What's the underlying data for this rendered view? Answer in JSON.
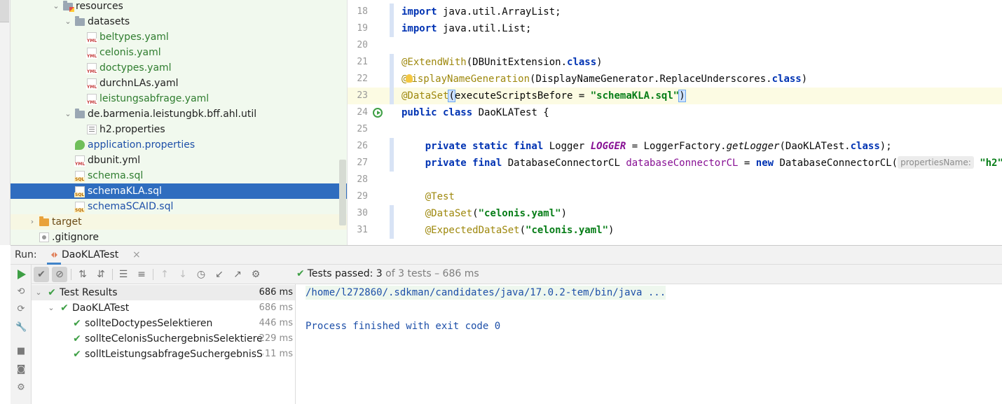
{
  "project_tree": {
    "items": [
      {
        "label": "resources",
        "icon": "resources-folder-icon",
        "color": "black",
        "depth": 3,
        "expanded": true
      },
      {
        "label": "datasets",
        "icon": "folder-icon",
        "color": "black",
        "depth": 4,
        "expanded": true
      },
      {
        "label": "beltypes.yaml",
        "icon": "yaml-file-icon",
        "color": "green",
        "depth": 5
      },
      {
        "label": "celonis.yaml",
        "icon": "yaml-file-icon",
        "color": "green",
        "depth": 5
      },
      {
        "label": "doctypes.yaml",
        "icon": "yaml-file-icon",
        "color": "green",
        "depth": 5
      },
      {
        "label": "durchnLAs.yaml",
        "icon": "yaml-file-icon",
        "color": "black",
        "depth": 5
      },
      {
        "label": "leistungsabfrage.yaml",
        "icon": "yaml-file-icon",
        "color": "green",
        "depth": 5
      },
      {
        "label": "de.barmenia.leistungbk.bff.ahl.util",
        "icon": "folder-icon",
        "color": "black",
        "depth": 4,
        "expanded": true
      },
      {
        "label": "h2.properties",
        "icon": "properties-file-icon",
        "color": "black",
        "depth": 5
      },
      {
        "label": "application.properties",
        "icon": "spring-properties-icon",
        "color": "blue",
        "depth": 4
      },
      {
        "label": "dbunit.yml",
        "icon": "yaml-file-icon",
        "color": "black",
        "depth": 4
      },
      {
        "label": "schema.sql",
        "icon": "sql-file-icon",
        "color": "green",
        "depth": 4
      },
      {
        "label": "schemaKLA.sql",
        "icon": "sql-file-icon",
        "color": "white",
        "depth": 4,
        "selected": true
      },
      {
        "label": "schemaSCAID.sql",
        "icon": "sql-file-icon",
        "color": "blue",
        "depth": 4
      },
      {
        "label": "target",
        "icon": "excluded-folder-icon",
        "color": "brown",
        "depth": 1,
        "expanded": false
      },
      {
        "label": ".gitignore",
        "icon": "gitignore-file-icon",
        "color": "black",
        "depth": 1
      }
    ]
  },
  "editor": {
    "lines": [
      {
        "n": "18",
        "tokens": [
          [
            "kw",
            "import"
          ],
          [
            "",
            "java.util.ArrayList;"
          ]
        ]
      },
      {
        "n": "19",
        "tokens": [
          [
            "kw",
            "import"
          ],
          [
            "",
            "java.util.List;"
          ]
        ]
      },
      {
        "n": "20",
        "tokens": []
      },
      {
        "n": "21",
        "tokens": [
          [
            "ann",
            "@ExtendWith"
          ],
          [
            "",
            "(DBUnitExtension."
          ],
          [
            "kw",
            "class"
          ],
          [
            "",
            ")"
          ]
        ]
      },
      {
        "n": "22",
        "tokens": [
          [
            "ann",
            "@"
          ],
          [
            "bulb",
            ""
          ],
          [
            "ann",
            "isplayNameGeneration"
          ],
          [
            "",
            "(DisplayNameGenerator.ReplaceUnderscores."
          ],
          [
            "kw",
            "class"
          ],
          [
            "",
            ")"
          ]
        ]
      },
      {
        "n": "23",
        "tokens": [
          [
            "ann",
            "@DataSet"
          ],
          [
            "bracket",
            "("
          ],
          [
            "",
            "executeScriptsBefore = "
          ],
          [
            "str",
            "\"schemaKLA.sql\""
          ],
          [
            "bracket",
            ")"
          ]
        ],
        "current": true
      },
      {
        "n": "24",
        "tokens": [
          [
            "kw",
            "public class"
          ],
          [
            "",
            " DaoKLATest {"
          ]
        ],
        "run": true
      },
      {
        "n": "25",
        "tokens": []
      },
      {
        "n": "26",
        "tokens": [
          [
            "",
            "    "
          ],
          [
            "kw",
            "private static final"
          ],
          [
            "",
            " Logger "
          ],
          [
            "fld-i",
            "LOGGER"
          ],
          [
            "",
            " = LoggerFactory."
          ],
          [
            "meth-i",
            "getLogger"
          ],
          [
            "",
            "(DaoKLATest."
          ],
          [
            "kw",
            "class"
          ],
          [
            "",
            ");"
          ]
        ]
      },
      {
        "n": "27",
        "tokens": [
          [
            "",
            "    "
          ],
          [
            "kw",
            "private final"
          ],
          [
            "",
            " DatabaseConnectorCL "
          ],
          [
            "fld",
            "databaseConnectorCL"
          ],
          [
            "",
            " = "
          ],
          [
            "kw",
            "new"
          ],
          [
            "",
            " DatabaseConnectorCL("
          ],
          [
            "hint",
            "propertiesName:"
          ],
          [
            "",
            " "
          ],
          [
            "str",
            "\"h2\""
          ],
          [
            "",
            ");"
          ]
        ]
      },
      {
        "n": "28",
        "tokens": []
      },
      {
        "n": "29",
        "tokens": [
          [
            "",
            "    "
          ],
          [
            "ann",
            "@Test"
          ]
        ]
      },
      {
        "n": "30",
        "tokens": [
          [
            "",
            "    "
          ],
          [
            "ann",
            "@DataSet"
          ],
          [
            "",
            "("
          ],
          [
            "str",
            "\"celonis.yaml\""
          ],
          [
            "",
            ")"
          ]
        ]
      },
      {
        "n": "31",
        "tokens": [
          [
            "",
            "    "
          ],
          [
            "ann",
            "@ExpectedDataSet"
          ],
          [
            "",
            "("
          ],
          [
            "str",
            "\"celonis.yaml\""
          ],
          [
            "",
            ")"
          ]
        ]
      }
    ]
  },
  "run_window": {
    "title": "Run:",
    "tab_label": "DaoKLATest",
    "tab_close": "×",
    "status": {
      "prefix": "Tests passed: ",
      "passed": "3",
      "suffix": " of 3 tests – 686 ms"
    },
    "results": [
      {
        "label": "Test Results",
        "time": "686 ms",
        "depth": 0,
        "root": true,
        "arrow": true
      },
      {
        "label": "DaoKLATest",
        "time": "686 ms",
        "depth": 1,
        "arrow": true
      },
      {
        "label": "sollteDoctypesSelektieren",
        "time": "446 ms",
        "depth": 2
      },
      {
        "label": "sollteCelonisSuchergebnisSelektieren",
        "time": "229 ms",
        "depth": 2
      },
      {
        "label": "solltLeistungsabfrageSuchergebnisSelektieren",
        "time": "11 ms",
        "depth": 2
      }
    ],
    "console": {
      "line1": "/home/l272860/.sdkman/candidates/java/17.0.2-tem/bin/java ...",
      "line2": "Process finished with exit code 0"
    }
  },
  "colors": {
    "selection": "#2f6dbf",
    "tree_bg": "#f1f9ee",
    "pass_green": "#3e9f45",
    "keyword": "#0033b3",
    "string": "#067d17",
    "annotation": "#9e880d"
  }
}
